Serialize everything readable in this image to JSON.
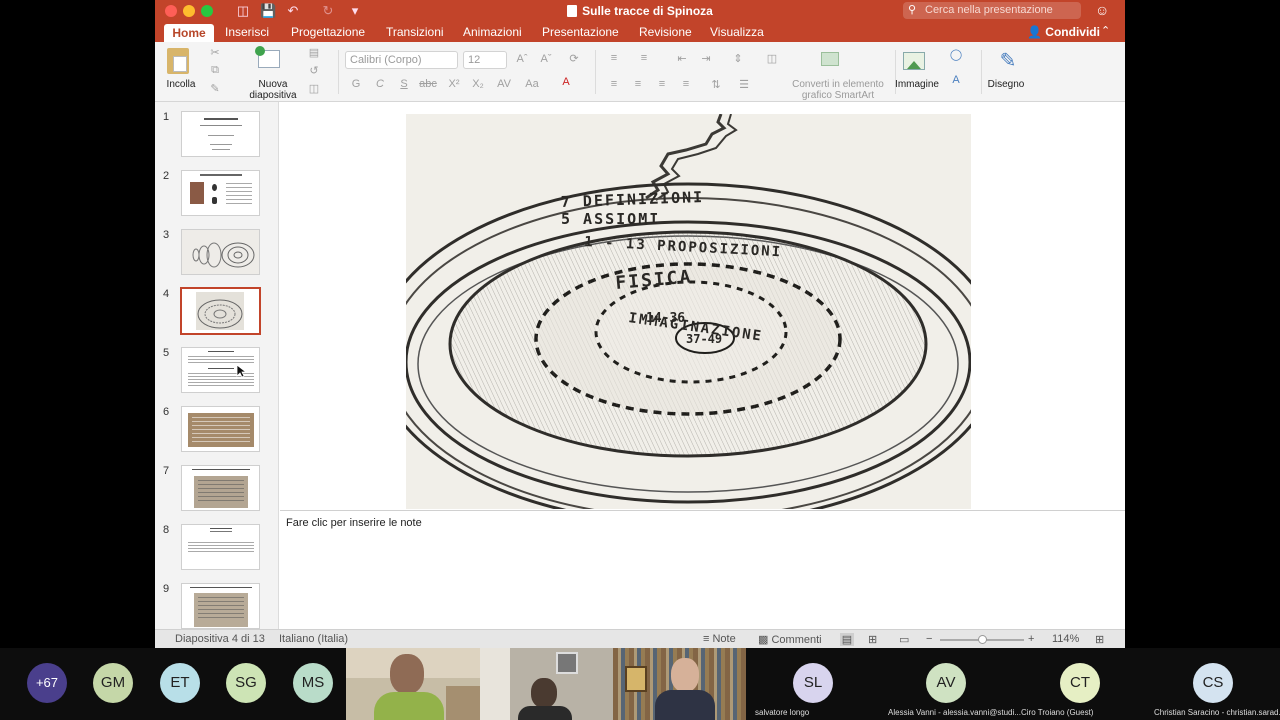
{
  "window": {
    "title": "Sulle tracce di Spinoza",
    "search_placeholder": "Cerca nella presentazione"
  },
  "tabs": [
    "Home",
    "Inserisci",
    "Progettazione",
    "Transizioni",
    "Animazioni",
    "Presentazione",
    "Revisione",
    "Visualizza"
  ],
  "share_label": "Condividi",
  "ribbon": {
    "paste_label": "Incolla",
    "new_slide_label_1": "Nuova",
    "new_slide_label_2": "diapositiva",
    "font_name": "Calibri (Corpo)",
    "font_size": "12",
    "format_buttons": [
      "G",
      "C",
      "S",
      "abc",
      "X²",
      "X₂"
    ],
    "smartart_label_1": "Converti in elemento",
    "smartart_label_2": "grafico SmartArt",
    "image_label": "Immagine",
    "draw_label": "Disegno"
  },
  "slides": {
    "numbers": [
      "1",
      "2",
      "3",
      "4",
      "5",
      "6",
      "7",
      "8",
      "9"
    ],
    "selected": 4
  },
  "sketch": {
    "labels": [
      "7 DEFINIZIONI",
      "5 ASSIOMI",
      "1 - 13 PROPOSIZIONI",
      "FISICA",
      "IMMAGINAZIONE",
      "14-36",
      "37-49"
    ]
  },
  "notes_placeholder": "Fare clic per inserire le note",
  "status": {
    "slide_counter": "Diapositiva 4 di 13",
    "language": "Italiano (Italia)",
    "notes_label": "Note",
    "comments_label": "Commenti",
    "zoom": "114%"
  },
  "participants": {
    "more_count": "+67",
    "avatars": [
      {
        "initials": "GM",
        "color": "#c5d7a8"
      },
      {
        "initials": "ET",
        "color": "#b8dfe8"
      },
      {
        "initials": "SG",
        "color": "#cde4b5"
      },
      {
        "initials": "MS",
        "color": "#b9dcc9"
      }
    ],
    "named_tiles": [
      {
        "initials": "SL",
        "name": "salvatore longo",
        "color": "#d8d4ee"
      },
      {
        "initials": "AV",
        "name": "Alessia Vanni - alessia.vanni@studi...",
        "color": "#cfe2c2"
      },
      {
        "initials": "CT",
        "name": "Ciro Troiano (Guest)",
        "color": "#e6efc4"
      },
      {
        "initials": "CS",
        "name": "Christian Saracino - christian.sarad...",
        "color": "#d4e3f0"
      }
    ]
  }
}
